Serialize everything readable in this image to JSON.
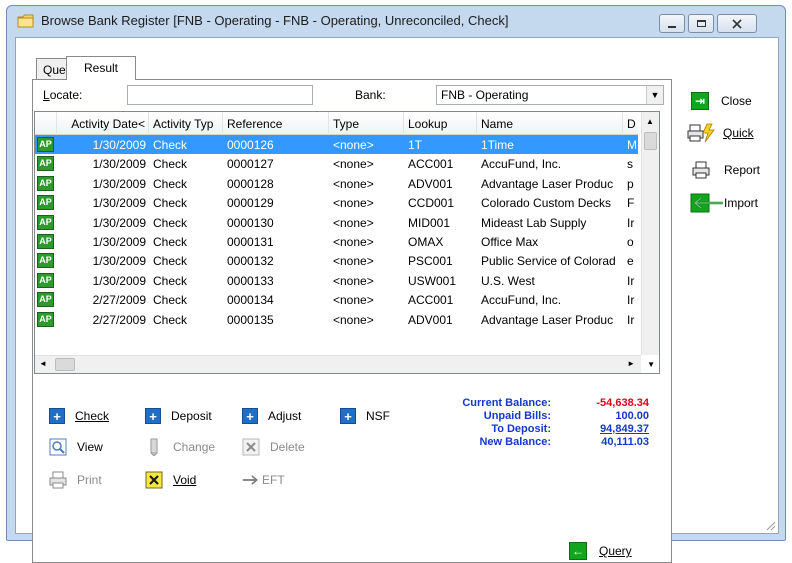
{
  "window": {
    "title": "Browse Bank Register [FNB - Operating - FNB - Operating, Unreconciled, Check]"
  },
  "tabs": [
    {
      "label": "Query",
      "active": false
    },
    {
      "label": "Result",
      "active": true
    }
  ],
  "locate": {
    "label": "Locate:",
    "value": ""
  },
  "bank": {
    "label": "Bank:",
    "value": "FNB - Operating"
  },
  "grid": {
    "columns": [
      "Activity Date<",
      "Activity Typ",
      "Reference",
      "Type",
      "Lookup",
      "Name",
      "D"
    ],
    "rows": [
      {
        "badge": "AP",
        "date": "1/30/2009",
        "activity": "Check",
        "reference": "0000126",
        "type": "<none>",
        "lookup": "1T",
        "name": "1Time",
        "d": "M",
        "selected": true
      },
      {
        "badge": "AP",
        "date": "1/30/2009",
        "activity": "Check",
        "reference": "0000127",
        "type": "<none>",
        "lookup": "ACC001",
        "name": "AccuFund, Inc.",
        "d": "s"
      },
      {
        "badge": "AP",
        "date": "1/30/2009",
        "activity": "Check",
        "reference": "0000128",
        "type": "<none>",
        "lookup": "ADV001",
        "name": "Advantage Laser Produc",
        "d": "p"
      },
      {
        "badge": "AP",
        "date": "1/30/2009",
        "activity": "Check",
        "reference": "0000129",
        "type": "<none>",
        "lookup": "CCD001",
        "name": "Colorado Custom Decks",
        "d": "F"
      },
      {
        "badge": "AP",
        "date": "1/30/2009",
        "activity": "Check",
        "reference": "0000130",
        "type": "<none>",
        "lookup": "MID001",
        "name": "Mideast Lab Supply",
        "d": "Ir"
      },
      {
        "badge": "AP",
        "date": "1/30/2009",
        "activity": "Check",
        "reference": "0000131",
        "type": "<none>",
        "lookup": "OMAX",
        "name": "Office Max",
        "d": "o"
      },
      {
        "badge": "AP",
        "date": "1/30/2009",
        "activity": "Check",
        "reference": "0000132",
        "type": "<none>",
        "lookup": "PSC001",
        "name": "Public Service of Colorad",
        "d": "e"
      },
      {
        "badge": "AP",
        "date": "1/30/2009",
        "activity": "Check",
        "reference": "0000133",
        "type": "<none>",
        "lookup": "USW001",
        "name": "U.S. West",
        "d": "Ir"
      },
      {
        "badge": "AP",
        "date": "2/27/2009",
        "activity": "Check",
        "reference": "0000134",
        "type": "<none>",
        "lookup": "ACC001",
        "name": "AccuFund, Inc.",
        "d": "Ir"
      },
      {
        "badge": "AP",
        "date": "2/27/2009",
        "activity": "Check",
        "reference": "0000135",
        "type": "<none>",
        "lookup": "ADV001",
        "name": "Advantage Laser Produc",
        "d": "Ir"
      }
    ]
  },
  "actions": {
    "check": "Check",
    "deposit": "Deposit",
    "adjust": "Adjust",
    "nsf": "NSF",
    "view": "View",
    "change": "Change",
    "delete": "Delete",
    "print": "Print",
    "void": "Void",
    "eft": "EFT",
    "query": "Query"
  },
  "balances": {
    "current_label": "Current Balance:",
    "current_value": "-54,638.34",
    "unpaid_label": "Unpaid Bills:",
    "unpaid_value": "100.00",
    "deposit_label": "To Deposit:",
    "deposit_value": "94,849.37",
    "new_label": "New Balance:",
    "new_value": "40,111.03"
  },
  "side": {
    "close": "Close",
    "quick": "Quick",
    "report": "Report",
    "import": "Import"
  },
  "colors": {
    "negative": "#e0001a",
    "link_blue": "#1638c9",
    "selection": "#3399ff",
    "badge_green": "#2e9a2e"
  }
}
